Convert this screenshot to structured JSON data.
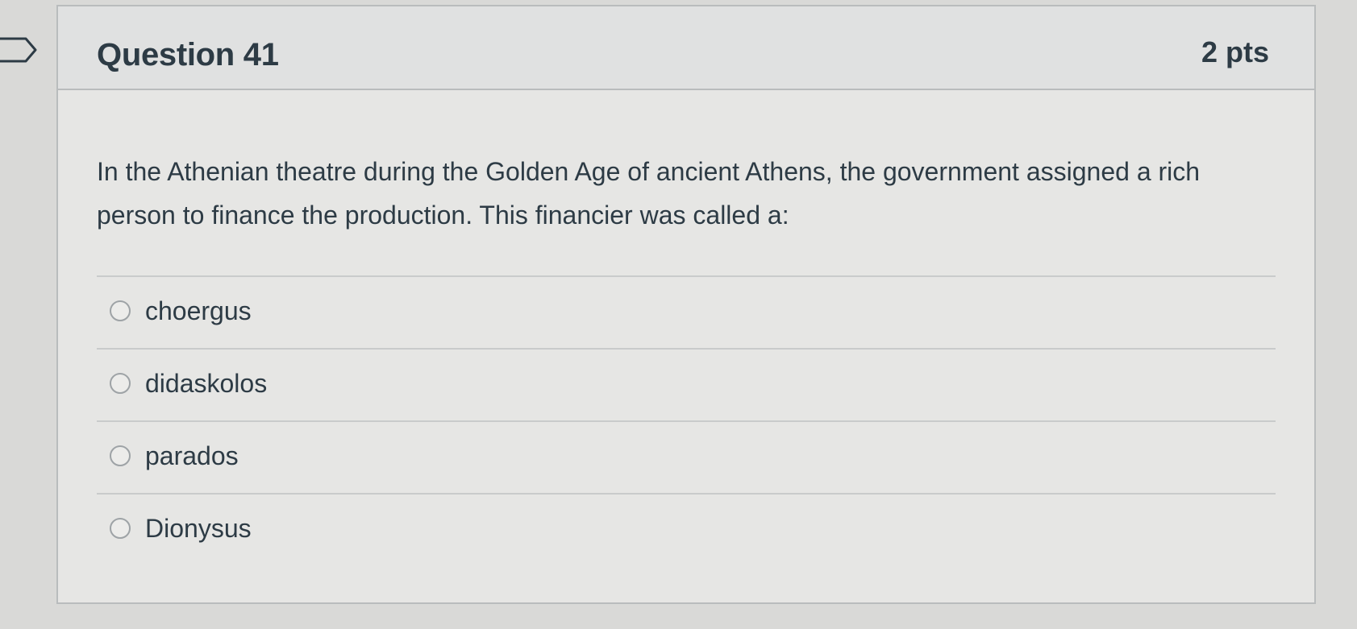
{
  "question": {
    "title": "Question 41",
    "points": "2 pts",
    "text": "In the Athenian theatre during the Golden Age of ancient Athens, the government assigned a rich person to finance the production.  This financier was called a:",
    "answers": [
      {
        "label": "choergus",
        "selected": false
      },
      {
        "label": "didaskolos",
        "selected": false
      },
      {
        "label": "parados",
        "selected": false
      },
      {
        "label": "Dionysus",
        "selected": false
      }
    ]
  },
  "icons": {
    "flag": "flag-icon",
    "radio": "radio-unchecked-icon"
  },
  "colors": {
    "text": "#2d3b45",
    "card_border": "#b9bcbd",
    "header_bg": "#e0e1e1"
  }
}
